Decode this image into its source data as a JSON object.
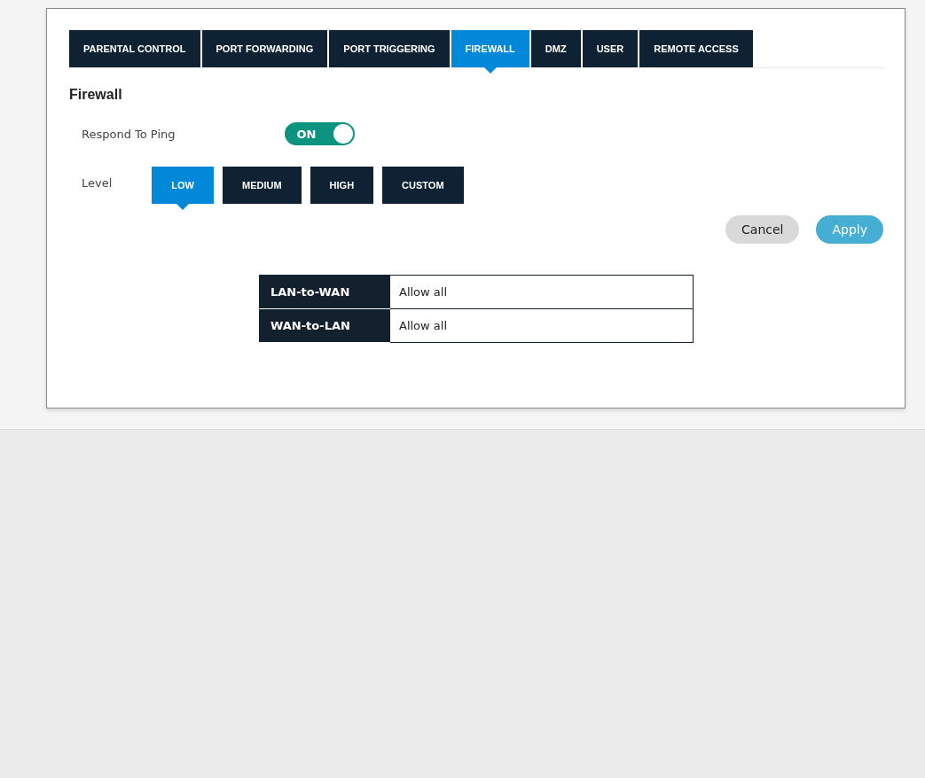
{
  "tabs": [
    {
      "label": "PARENTAL CONTROL",
      "selected": false
    },
    {
      "label": "PORT FORWARDING",
      "selected": false
    },
    {
      "label": "PORT TRIGGERING",
      "selected": false
    },
    {
      "label": "FIREWALL",
      "selected": true
    },
    {
      "label": "DMZ",
      "selected": false
    },
    {
      "label": "USER",
      "selected": false
    },
    {
      "label": "REMOTE ACCESS",
      "selected": false
    }
  ],
  "heading": "Firewall",
  "respond_to_ping": {
    "label": "Respond To Ping",
    "on": true,
    "state_text": "ON"
  },
  "level": {
    "label": "Level",
    "options": [
      {
        "label": "LOW",
        "selected": true
      },
      {
        "label": "MEDIUM",
        "selected": false
      },
      {
        "label": "HIGH",
        "selected": false
      },
      {
        "label": "CUSTOM",
        "selected": false
      }
    ]
  },
  "buttons": {
    "cancel": "Cancel",
    "apply": "Apply"
  },
  "rules": [
    {
      "direction": "LAN-to-WAN",
      "policy": "Allow all"
    },
    {
      "direction": "WAN-to-LAN",
      "policy": "Allow all"
    }
  ]
}
